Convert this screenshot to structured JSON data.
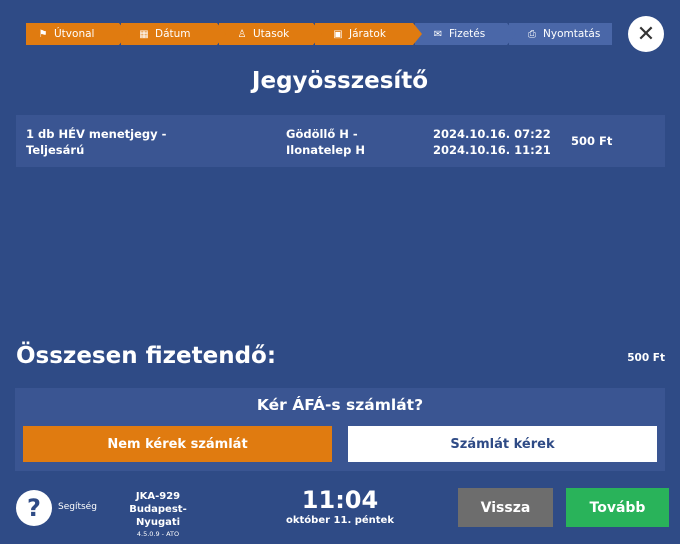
{
  "stepper": {
    "steps": [
      {
        "label": "Útvonal",
        "icon": "flag-icon",
        "glyph": "⚑",
        "state": "done"
      },
      {
        "label": "Dátum",
        "icon": "calendar-icon",
        "glyph": "▦",
        "state": "done"
      },
      {
        "label": "Utasok",
        "icon": "person-icon",
        "glyph": "♙",
        "state": "done"
      },
      {
        "label": "Járatok",
        "icon": "train-icon",
        "glyph": "▣",
        "state": "done"
      },
      {
        "label": "Fizetés",
        "icon": "money-icon",
        "glyph": "✉",
        "state": "todo"
      },
      {
        "label": "Nyomtatás",
        "icon": "printer-icon",
        "glyph": "⎙",
        "state": "todo"
      }
    ]
  },
  "close_glyph": "✕",
  "title": "Jegyösszesítő",
  "ticket": {
    "name_line1": "1 db HÉV menetjegy -",
    "name_line2": "Teljesárú",
    "route_line1": "Gödöllő H -",
    "route_line2": "Ilonatelep H",
    "valid_from": "2024.10.16. 07:22",
    "valid_to": "2024.10.16. 11:21",
    "price": "500 Ft"
  },
  "total": {
    "label": "Összesen fizetendő:",
    "value": "500 Ft"
  },
  "invoice": {
    "question": "Kér ÁFÁ-s számlát?",
    "no_label": "Nem kérek számlát",
    "yes_label": "Számlát kérek"
  },
  "footer": {
    "help_glyph": "?",
    "help_label": "Segítség",
    "device_id": "JKA-929",
    "device_location": "Budapest-Nyugati",
    "version": "4.5.0.9 - ATO",
    "time": "11:04",
    "date": "október 11. péntek",
    "back_label": "Vissza",
    "next_label": "Tovább"
  },
  "colors": {
    "background": "#2f4b86",
    "panel": "#3a5592",
    "step_done": "#e07b10",
    "step_todo": "#4a67a8",
    "primary_action": "#29b35a",
    "secondary_action": "#6d6d6d"
  }
}
